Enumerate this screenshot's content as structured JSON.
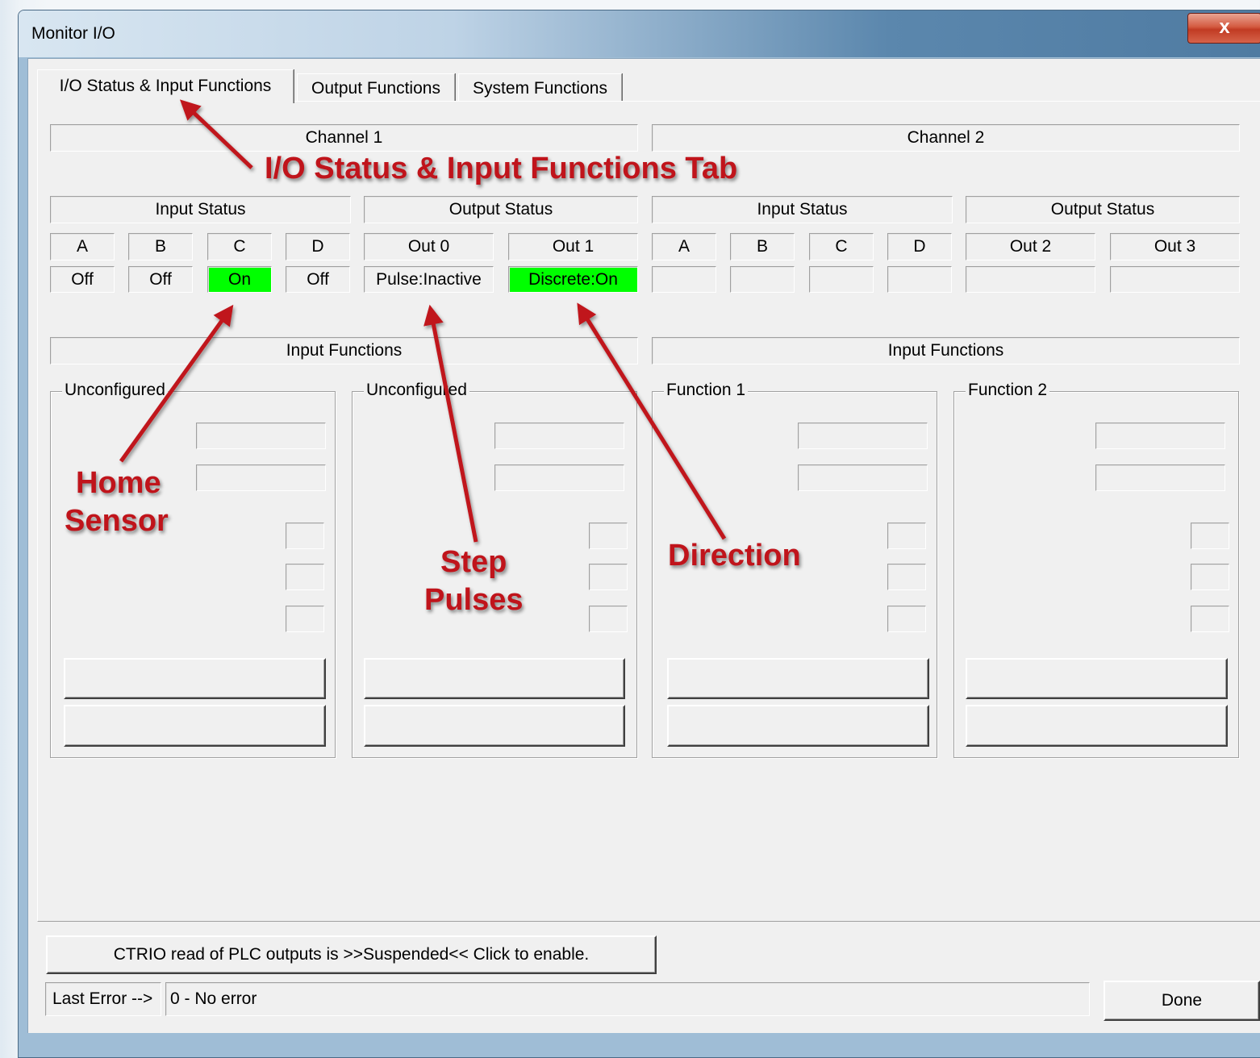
{
  "window": {
    "title": "Monitor I/O",
    "close_glyph": "x"
  },
  "tabs": [
    {
      "label": "I/O Status & Input Functions",
      "active": true
    },
    {
      "label": "Output Functions",
      "active": false
    },
    {
      "label": "System Functions",
      "active": false
    }
  ],
  "channel1": {
    "header": "Channel 1",
    "input_status_label": "Input Status",
    "output_status_label": "Output Status",
    "inputs": [
      {
        "name": "A",
        "value": "Off",
        "active": false
      },
      {
        "name": "B",
        "value": "Off",
        "active": false
      },
      {
        "name": "C",
        "value": "On",
        "active": true
      },
      {
        "name": "D",
        "value": "Off",
        "active": false
      }
    ],
    "outputs": [
      {
        "name": "Out 0",
        "value": "Pulse:Inactive",
        "active": false
      },
      {
        "name": "Out 1",
        "value": "Discrete:On",
        "active": true
      }
    ],
    "input_functions_label": "Input Functions",
    "function_groups": [
      "Unconfigured",
      "Unconfigured"
    ]
  },
  "channel2": {
    "header": "Channel 2",
    "input_status_label": "Input Status",
    "output_status_label": "Output Status",
    "inputs": [
      {
        "name": "A",
        "value": ""
      },
      {
        "name": "B",
        "value": ""
      },
      {
        "name": "C",
        "value": ""
      },
      {
        "name": "D",
        "value": ""
      }
    ],
    "outputs": [
      {
        "name": "Out 2",
        "value": ""
      },
      {
        "name": "Out 3",
        "value": ""
      }
    ],
    "input_functions_label": "Input Functions",
    "function_groups": [
      "Function 1",
      "Function 2"
    ]
  },
  "footer": {
    "ctrio_button": "CTRIO read of PLC outputs is >>Suspended<< Click to enable.",
    "last_error_label": "Last Error -->",
    "last_error_value": "0 - No error",
    "done_button": "Done"
  },
  "annotations": {
    "tab_callout": "I/O Status & Input Functions Tab",
    "home_sensor": [
      "Home",
      "Sensor"
    ],
    "step_pulses": [
      "Step",
      "Pulses"
    ],
    "direction": "Direction",
    "color": "#c0141b"
  },
  "colors": {
    "active_indicator": "#00ff00"
  }
}
